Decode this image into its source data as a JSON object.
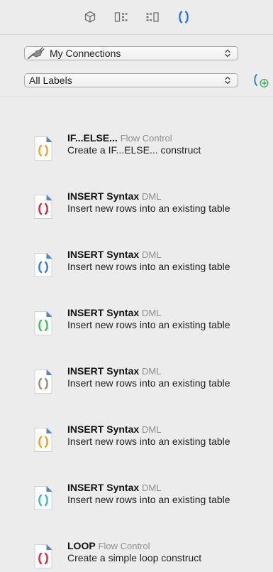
{
  "toolbar": {
    "buttons": [
      {
        "icon": "cube-icon",
        "active": false
      },
      {
        "icon": "schema-icon",
        "active": false
      },
      {
        "icon": "columns-icon",
        "active": false
      },
      {
        "icon": "snippets-icon",
        "active": true
      }
    ]
  },
  "connections": {
    "value": "My Connections",
    "icon": "plug-icon"
  },
  "labels": {
    "value": "All Labels",
    "add_icon": "add-label-icon"
  },
  "snippets": [
    {
      "title": "IF...ELSE...",
      "category": "Flow Control",
      "description": "Create a IF...ELSE... construct",
      "color": "#e8a33a"
    },
    {
      "title": "INSERT Syntax",
      "category": "DML",
      "description": "Insert new rows into an existing table",
      "color": "#d9263b"
    },
    {
      "title": "INSERT Syntax",
      "category": "DML",
      "description": "Insert new rows into an existing table",
      "color": "#2f7fd6"
    },
    {
      "title": "INSERT Syntax",
      "category": "DML",
      "description": "Insert new rows into an existing table",
      "color": "#3fbf5a"
    },
    {
      "title": "INSERT Syntax",
      "category": "DML",
      "description": "Insert new rows into an existing table",
      "color": "#9a8a70"
    },
    {
      "title": "INSERT Syntax",
      "category": "DML",
      "description": "Insert new rows into an existing table",
      "color": "#f0a020"
    },
    {
      "title": "INSERT Syntax",
      "category": "DML",
      "description": "Insert new rows into an existing table",
      "color": "#36b6c8"
    },
    {
      "title": "LOOP",
      "category": "Flow Control",
      "description": "Create a simple loop construct",
      "color": "#d9263b"
    }
  ],
  "colors": {
    "accent": "#1a73e8",
    "add_label": "#2fae4e",
    "background": "#ececec"
  }
}
